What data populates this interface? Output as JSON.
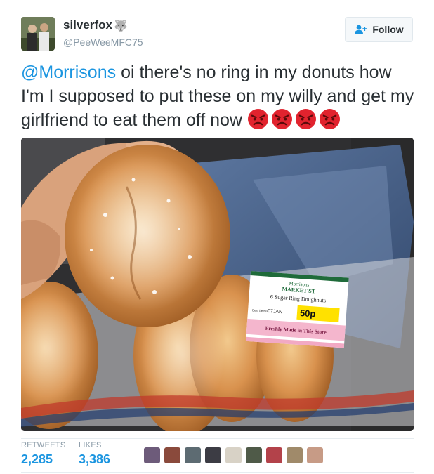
{
  "user": {
    "display_name": "silverfox",
    "name_icon": "wolf-icon",
    "handle": "@PeeWeeMFC75"
  },
  "follow_button": {
    "label": "Follow",
    "icon": "add-user-icon"
  },
  "tweet": {
    "mention": "@Morrisons",
    "text": " oi there's no ring in my donuts how I'm I supposed to put these on my willy and get my girlfriend to eat them off now ",
    "emoji": [
      "angry-face-icon",
      "angry-face-icon",
      "angry-face-icon",
      "angry-face-icon"
    ]
  },
  "photo_label": {
    "brand": "Morrisons",
    "subbrand": "MARKET ST",
    "product": "6 Sugar Ring Doughnuts",
    "best_before_label": "Best before",
    "best_before": "07JAN",
    "price": "50p",
    "tagline": "Freshly Made in This Store"
  },
  "stats": {
    "retweets_label": "RETWEETS",
    "retweets": "2,285",
    "likes_label": "LIKES",
    "likes": "3,386"
  },
  "colors": {
    "link": "#1b95e0",
    "angry": "#e1232e",
    "muted": "#8899a6"
  }
}
